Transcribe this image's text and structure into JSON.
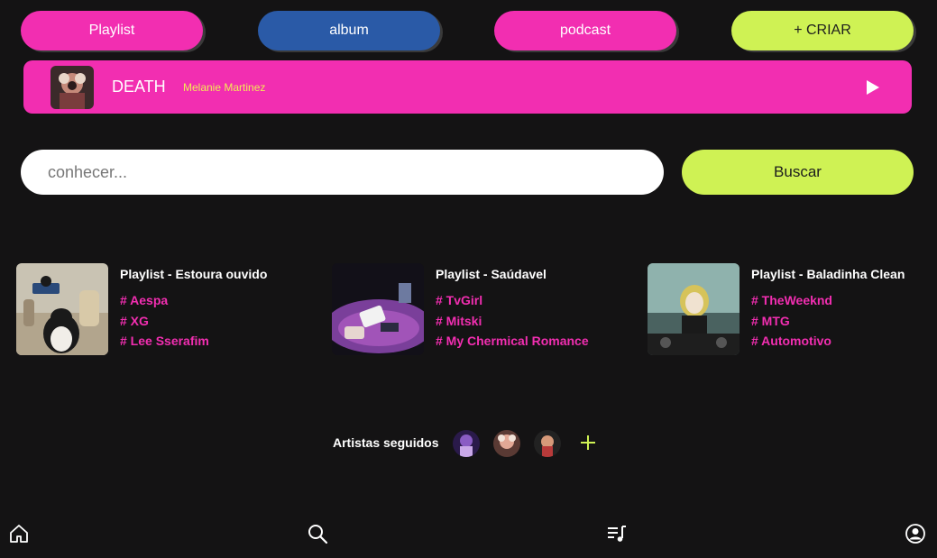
{
  "top_buttons": {
    "playlist": "Playlist",
    "album": "album",
    "podcast": "podcast",
    "create": "+ CRIAR"
  },
  "now_playing": {
    "title": "DEATH",
    "artist": "Melanie Martinez",
    "cover_icon": "album-cover",
    "play_icon": "play-icon"
  },
  "search": {
    "placeholder": "conhecer...",
    "value": "",
    "button_label": "Buscar"
  },
  "playlists": [
    {
      "title": "Playlist - Estoura ouvido",
      "tags": [
        "# Aespa",
        "# XG",
        "# Lee Sserafim"
      ]
    },
    {
      "title": "Playlist - Saúdavel",
      "tags": [
        "# TvGirl",
        "# Mitski",
        "# My Chermical Romance"
      ]
    },
    {
      "title": "Playlist - Baladinha Clean",
      "tags": [
        "# TheWeeknd",
        "# MTG",
        "# Automotivo"
      ]
    }
  ],
  "followed": {
    "label": "Artistas seguidos",
    "add_icon": "plus-icon"
  },
  "bottom_nav": {
    "items": [
      "home-icon",
      "search-icon",
      "queue-music-icon",
      "profile-icon"
    ]
  },
  "colors": {
    "background": "#141314",
    "pink": "#f22eb1",
    "blue": "#2a5aa7",
    "lime": "#cff254",
    "artist_yellow": "#f3ea56"
  }
}
